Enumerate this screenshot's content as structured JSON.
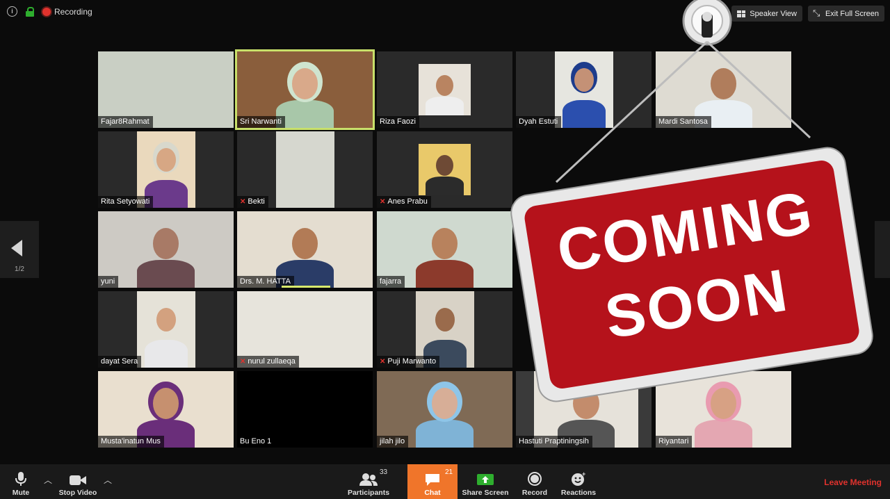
{
  "topbar": {
    "recording_label": "Recording",
    "speaker_view_label": "Speaker View",
    "exit_fullscreen_label": "Exit Full Screen"
  },
  "pager": {
    "page_label": "1/2"
  },
  "participants_grid": [
    {
      "name": "Fajar8Rahmat",
      "muted": false
    },
    {
      "name": "Sri Narwanti",
      "muted": false,
      "active": true
    },
    {
      "name": "Riza Faozi",
      "muted": false
    },
    {
      "name": "Dyah Estuti",
      "muted": false
    },
    {
      "name": "Mardi Santosa",
      "muted": false
    },
    {
      "name": "Rita Setyowati",
      "muted": false
    },
    {
      "name": "Bekti",
      "muted": true
    },
    {
      "name": "Anes Prabu",
      "muted": true
    },
    {
      "name": "yuni",
      "muted": false
    },
    {
      "name": "Drs. M. HATTA",
      "muted": false,
      "speaking": true
    },
    {
      "name": "fajarra",
      "muted": false
    },
    {
      "name": "dayat Sera",
      "muted": false
    },
    {
      "name": "nurul zullaeqa",
      "muted": true
    },
    {
      "name": "Puji Marwanto",
      "muted": true
    },
    {
      "name": "Musta'inatun Mus",
      "muted": false
    },
    {
      "name": "Bu Eno 1",
      "muted": false
    },
    {
      "name": "jilah jilo",
      "muted": false
    },
    {
      "name": "Hastuti Praptiningsih",
      "muted": false
    },
    {
      "name": "Riyantari",
      "muted": false
    }
  ],
  "overlay_sign": {
    "line1": "COMING",
    "line2": "SOON",
    "color": "#b5121b"
  },
  "toolbar": {
    "mute_label": "Mute",
    "stop_video_label": "Stop Video",
    "participants_label": "Participants",
    "participants_count": "33",
    "chat_label": "Chat",
    "chat_count": "21",
    "share_screen_label": "Share Screen",
    "record_label": "Record",
    "reactions_label": "Reactions",
    "leave_label": "Leave Meeting"
  },
  "colors": {
    "accent_chat": "#f0752a",
    "active_border": "#c8e06a",
    "leave": "#e0322d",
    "share": "#2eae2e"
  }
}
